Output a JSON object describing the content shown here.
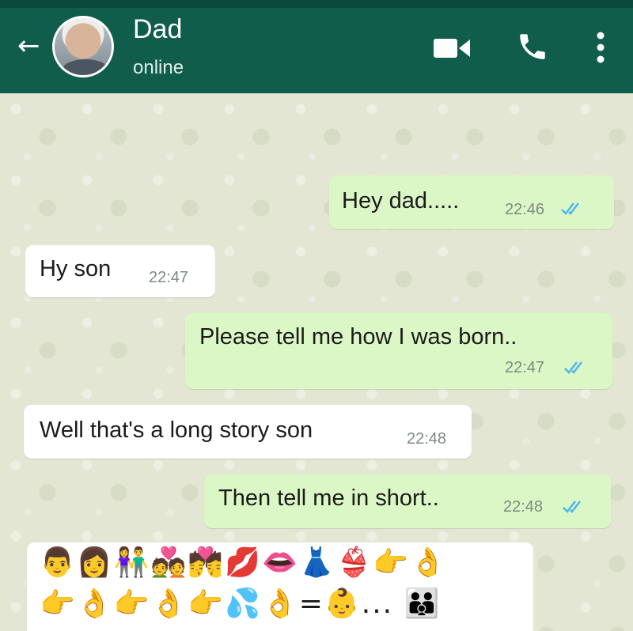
{
  "header": {
    "title": "Dad",
    "status": "online",
    "back_icon": "←",
    "icons": [
      "back-arrow-icon",
      "video-call-icon",
      "phone-icon",
      "more-vertical-icon"
    ]
  },
  "colors": {
    "header_bg": "#0f5d4a",
    "outgoing_bubble": "#dbf7c5",
    "incoming_bubble": "#ffffff",
    "read_ticks": "#4fb6ec",
    "chat_bg": "#e2e6d3"
  },
  "messages": [
    {
      "direction": "outgoing",
      "text": "Hey dad.....",
      "time": "22:46",
      "read": true
    },
    {
      "direction": "incoming",
      "text": "Hy son",
      "time": "22:47"
    },
    {
      "direction": "outgoing",
      "text": "Please tell me how I was born..",
      "time": "22:47",
      "read": true
    },
    {
      "direction": "incoming",
      "text": "Well that's a long story son",
      "time": "22:48"
    },
    {
      "direction": "outgoing",
      "text": "Then tell me in short..",
      "time": "22:48",
      "read": true
    },
    {
      "direction": "incoming",
      "emoji_line1": "👨👩👫💑💏💋👄👗👙👉👌",
      "emoji_line2": "👉👌👉👌👉💦👌=👶... 👪"
    }
  ]
}
